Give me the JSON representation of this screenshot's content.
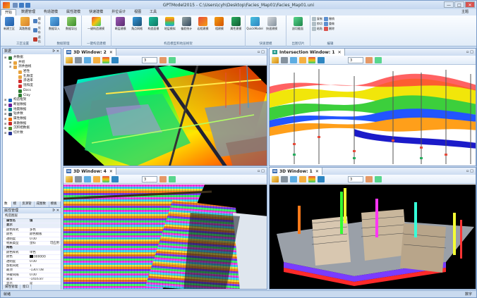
{
  "app": {
    "title": "GPTModel2015 - C:\\Users\\cyh\\Desktop\\Facies_Map01\\Facies_Map01.uni",
    "min_label": "—",
    "max_label": "□",
    "close_label": "✕"
  },
  "menu": {
    "items": [
      "开始",
      "数据管理",
      "构造建模",
      "属性建模",
      "快速建模",
      "井位设计",
      "视图",
      "工具"
    ],
    "active": "开始",
    "right_label": "主题"
  },
  "ribbon": {
    "groups": [
      {
        "label": "工区设置",
        "buttons": [
          "新建工区",
          "离散数据"
        ],
        "small": [
          "保存",
          "另存",
          "退出"
        ]
      },
      {
        "label": "数据管理",
        "buttons": [
          "数据导入",
          "数据导出"
        ]
      },
      {
        "label": "一键构造建模",
        "buttons": [
          "一键构造建模"
        ]
      },
      {
        "label": "构造模型和地层格架",
        "buttons": [
          "断层建模",
          "角点网格",
          "构造面模",
          "地层模拟",
          "偏差统计",
          "岩相建模",
          "相建模",
          "属性建模"
        ]
      },
      {
        "label": "快速建模",
        "buttons": [
          "QuickModel",
          "快速建模"
        ]
      },
      {
        "label": "出图切片",
        "buttons": [
          "剖切截面"
        ]
      },
      {
        "label": "编辑",
        "small": [
          "复制",
          "剪切",
          "粘贴",
          "撤销",
          "重做",
          "删除"
        ]
      }
    ]
  },
  "panel": {
    "title": "数据",
    "pin": "ᐅ ✕",
    "tree": [
      {
        "label": "井数据",
        "level": 0,
        "color": "#2e7d32"
      },
      {
        "label": "井组",
        "level": 1,
        "color": "#e8a33d"
      },
      {
        "label": "测井曲线",
        "level": 1,
        "color": "#e8a33d"
      },
      {
        "label": "岩性",
        "level": 2,
        "color": "#e8a33d"
      },
      {
        "label": "孔隙度",
        "level": 2,
        "color": "#e8a33d"
      },
      {
        "label": "渗透率",
        "level": 2,
        "color": "#d32f2f"
      },
      {
        "label": "饱和度",
        "level": 2,
        "color": "#d32f2f"
      },
      {
        "label": "Dzcs",
        "level": 2,
        "color": "#2e7d32"
      },
      {
        "label": "Clay",
        "level": 2,
        "color": "#2e7d32"
      },
      {
        "label": "构造框架",
        "level": 0,
        "color": "#1565c0"
      },
      {
        "label": "断层数据",
        "level": 0,
        "color": "#6a1b9a"
      },
      {
        "label": "地震数据",
        "level": 0,
        "color": "#00838f"
      },
      {
        "label": "钻井数",
        "level": 0,
        "color": "#455a64"
      },
      {
        "label": "属性数据",
        "level": 0,
        "color": "#ef6c00"
      },
      {
        "label": "离散数据",
        "level": 0,
        "color": "#c62828"
      },
      {
        "label": "沉积相数据",
        "level": 0,
        "color": "#558b2f"
      },
      {
        "label": "切片数",
        "level": 0,
        "color": "#283593"
      }
    ],
    "tabs": [
      "数据",
      "模型",
      "反演管理",
      "成图数据",
      "模板库"
    ],
    "active_tab": "数据"
  },
  "props": {
    "title": "属性管理",
    "button": "构造图层",
    "header": {
      "k": "属性名",
      "v": "值"
    },
    "rows": [
      {
        "k": "显示",
        "v": "",
        "cat": true
      },
      {
        "k": "颜色样式",
        "v": "多色"
      },
      {
        "k": "颜色",
        "v": "颜色模板"
      },
      {
        "k": "透明度",
        "v": "0.00"
      },
      {
        "k": "材质类型",
        "v": "塑料"
      },
      {
        "k": "网格",
        "v": "",
        "cat": true
      },
      {
        "k": "颜色样式",
        "v": "单色"
      },
      {
        "k": "颜色",
        "v": "000000",
        "swatch": "#000000"
      },
      {
        "k": "透明度",
        "v": "0.00"
      },
      {
        "k": "加粗间距",
        "v": "1"
      },
      {
        "k": "最顶",
        "v": "-1307.08"
      },
      {
        "k": "突破间隔",
        "v": "0.00"
      },
      {
        "k": "最深",
        "v": "-1416.87"
      },
      {
        "k": "显示",
        "v": "是"
      },
      {
        "k": "全部显示",
        "v": "是"
      },
      {
        "k": "字体大小",
        "v": "50"
      }
    ],
    "side_label": "可应用",
    "bottom_tabs": [
      "属性管理",
      "窗口"
    ]
  },
  "windows": [
    {
      "title": "3D Window: 2",
      "value": "3"
    },
    {
      "title": "Intersection Window: 1",
      "value": "3"
    },
    {
      "title": "3D Window: 4",
      "value": "3"
    },
    {
      "title": "3D Window: 1",
      "value": "3"
    }
  ],
  "status": {
    "left": "就绪",
    "right": "数字"
  }
}
